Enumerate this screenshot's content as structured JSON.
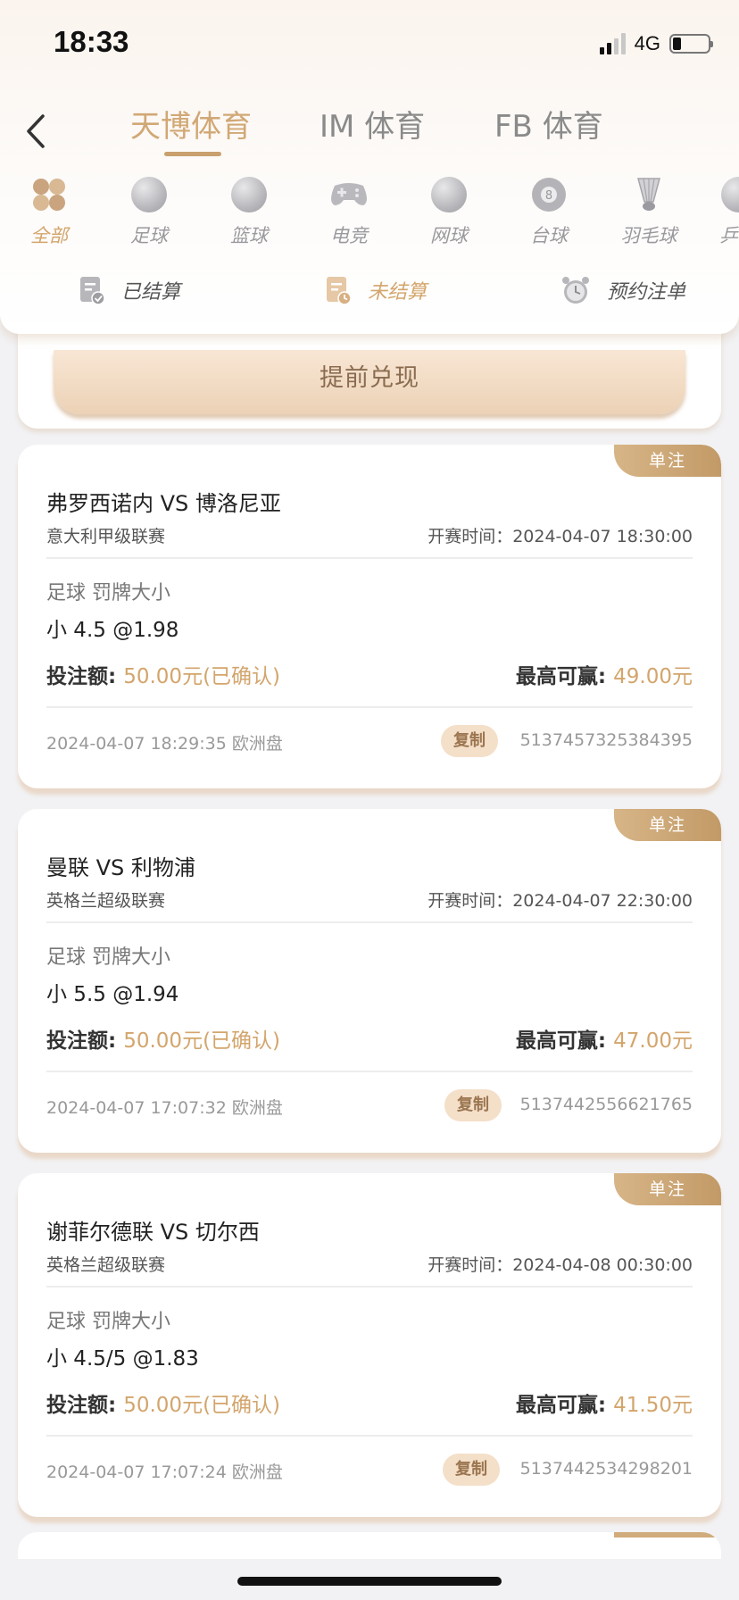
{
  "status_bar": {
    "time": "18:33",
    "network": "4G"
  },
  "tabs": [
    {
      "label": "天博体育",
      "active": true
    },
    {
      "label": "IM 体育",
      "active": false
    },
    {
      "label": "FB 体育",
      "active": false
    }
  ],
  "sports": [
    {
      "label": "全部",
      "icon": "all-sports-icon",
      "active": true
    },
    {
      "label": "足球",
      "icon": "football-icon"
    },
    {
      "label": "篮球",
      "icon": "basketball-icon"
    },
    {
      "label": "电竞",
      "icon": "gamepad-icon"
    },
    {
      "label": "网球",
      "icon": "tennis-icon"
    },
    {
      "label": "台球",
      "icon": "billiards-icon"
    },
    {
      "label": "羽毛球",
      "icon": "shuttlecock-icon"
    },
    {
      "label": "乒",
      "icon": "table-tennis-icon"
    }
  ],
  "sub_tabs": [
    {
      "label": "已结算",
      "icon": "settled-icon"
    },
    {
      "label": "未结算",
      "icon": "unsettled-icon",
      "active": true
    },
    {
      "label": "预约注单",
      "icon": "alarm-clock-icon"
    }
  ],
  "cashout": {
    "label": "提前兑现"
  },
  "bets": [
    {
      "tag": "单注",
      "match": "弗罗西诺内 VS 博洛尼亚",
      "league": "意大利甲级联赛",
      "start_time": "开赛时间：2024-04-07 18:30:00",
      "market": "足球 罚牌大小",
      "selection": "小 4.5 @1.98",
      "stake_label": "投注额: ",
      "stake_value": "50.00元(已确认)",
      "maxwin_label": "最高可赢: ",
      "maxwin_value": "49.00元",
      "bet_time": "2024-04-07 18:29:35 欧洲盘",
      "copy_label": "复制",
      "bet_id": "5137457325384395"
    },
    {
      "tag": "单注",
      "match": "曼联 VS 利物浦",
      "league": "英格兰超级联赛",
      "start_time": "开赛时间：2024-04-07 22:30:00",
      "market": "足球 罚牌大小",
      "selection": "小 5.5 @1.94",
      "stake_label": "投注额: ",
      "stake_value": "50.00元(已确认)",
      "maxwin_label": "最高可赢: ",
      "maxwin_value": "47.00元",
      "bet_time": "2024-04-07 17:07:32 欧洲盘",
      "copy_label": "复制",
      "bet_id": "5137442556621765"
    },
    {
      "tag": "单注",
      "match": "谢菲尔德联 VS 切尔西",
      "league": "英格兰超级联赛",
      "start_time": "开赛时间：2024-04-08 00:30:00",
      "market": "足球 罚牌大小",
      "selection": "小 4.5/5 @1.83",
      "stake_label": "投注额: ",
      "stake_value": "50.00元(已确认)",
      "maxwin_label": "最高可赢: ",
      "maxwin_value": "41.50元",
      "bet_time": "2024-04-07 17:07:24 欧洲盘",
      "copy_label": "复制",
      "bet_id": "5137442534298201"
    }
  ],
  "colors": {
    "accent": "#d3a56c",
    "tag": "#c9a06e",
    "copy_bg": "#f4dfc9"
  }
}
